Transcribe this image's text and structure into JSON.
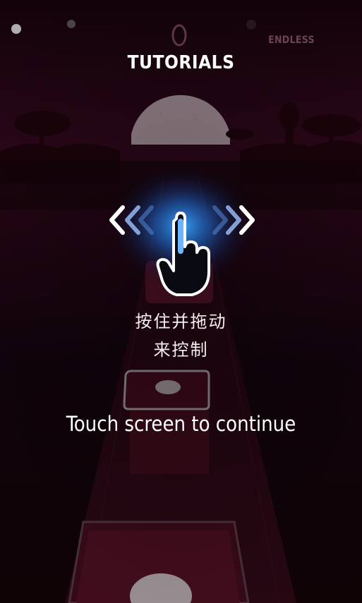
{
  "header": {
    "title": "TUTORIALS",
    "mode": "ENDLESS"
  },
  "instruction": {
    "line1": "按住并拖动",
    "line2": "来控制"
  },
  "prompt": "Touch screen to continue",
  "icons": {
    "gesture": "hand-swipe-icon",
    "left": "chevrons-left-icon",
    "right": "chevrons-right-icon"
  },
  "colors": {
    "background": "#120409",
    "glow": "#1e8cff",
    "tile": "#3b0e1c",
    "chevron": "#ffffff"
  }
}
